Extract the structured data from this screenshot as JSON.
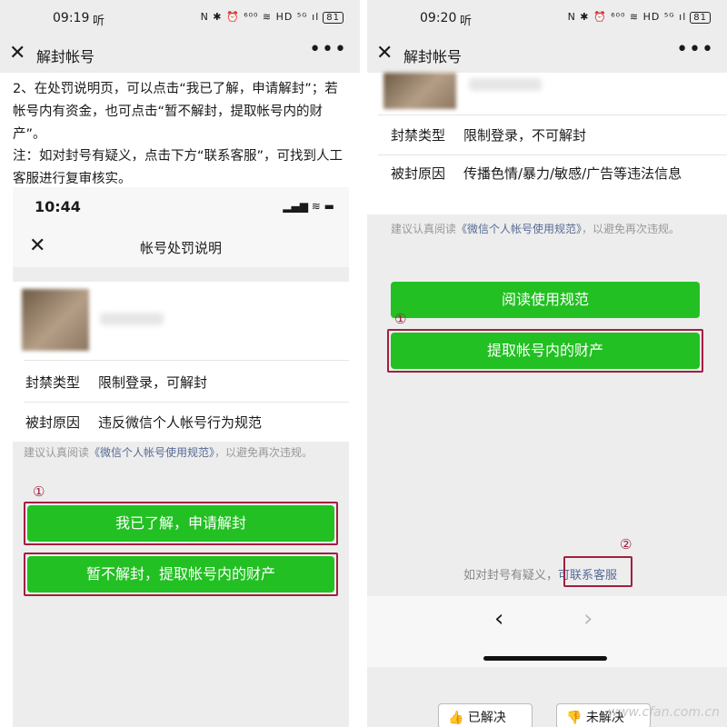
{
  "left": {
    "status": {
      "time": "09:19",
      "sym": "听",
      "icons": "N ✱ ⏰ ⁶⁰⁰ ≋ HD ⁵ᴳ ıl",
      "battery": "81"
    },
    "nav": {
      "close": "✕",
      "title": "解封帐号",
      "more": "•••"
    },
    "article": {
      "para1": "2、在处罚说明页，可以点击“我已了解，申请解封”；若帐号内有资金，也可点击“暂不解封，提取帐号内的财产”。",
      "para2": "注：如对封号有疑义，点击下方“联系客服”，可找到人工客服进行复审核实。"
    },
    "inner": {
      "time": "10:44",
      "icons": "▂▄▆ ≋ ▬",
      "close": "✕",
      "title": "帐号处罚说明",
      "rows": [
        {
          "key": "封禁类型",
          "value": "限制登录，可解封"
        },
        {
          "key": "被封原因",
          "value": "违反微信个人帐号行为规范"
        }
      ],
      "note_prefix": "建议认真阅读",
      "note_link": "《微信个人帐号使用规范》",
      "note_suffix": "，以避免再次违规。",
      "marker1": "①",
      "btn_apply": "我已了解，申请解封",
      "btn_withdraw": "暂不解封，提取帐号内的财产"
    }
  },
  "right": {
    "status": {
      "time": "09:20",
      "sym": "听",
      "icons": "N ✱ ⏰ ⁶⁰⁰ ≋ HD ⁵ᴳ ıl",
      "battery": "81"
    },
    "nav": {
      "close": "✕",
      "title": "解封帐号",
      "more": "•••"
    },
    "rows": [
      {
        "key": "封禁类型",
        "value": "限制登录，不可解封"
      },
      {
        "key": "被封原因",
        "value": "传播色情/暴力/敏感/广告等违法信息"
      }
    ],
    "note_prefix": "建议认真阅读",
    "note_link": "《微信个人帐号使用规范》",
    "note_suffix": "，以避免再次违规。",
    "btn_read": "阅读使用规范",
    "marker1": "①",
    "btn_withdraw": "提取帐号内的财产",
    "marker2": "②",
    "contact_prefix": "如对封号有疑义，",
    "contact_link": "可联系客服",
    "back": "‹",
    "forward": "›",
    "feedback_yes": "👍 已解决",
    "feedback_no": "👎 未解决",
    "watermark": "www.cfan.com.cn"
  }
}
